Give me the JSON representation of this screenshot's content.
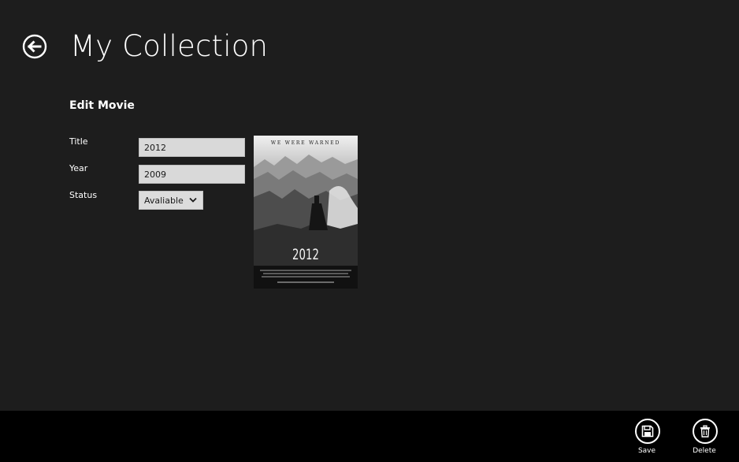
{
  "header": {
    "back_icon": "back-arrow-circle-icon",
    "title": "My Collection"
  },
  "form": {
    "heading": "Edit Movie",
    "fields": {
      "title": {
        "label": "Title",
        "value": "2012"
      },
      "year": {
        "label": "Year",
        "value": "2009"
      },
      "status": {
        "label": "Status",
        "selected": "Avaliable",
        "icon": "chevron-down-icon"
      }
    }
  },
  "poster": {
    "tagline": "WE WERE WARNED",
    "title": "2012"
  },
  "app_bar": {
    "buttons": [
      {
        "label": "Save",
        "icon": "save-disk-icon"
      },
      {
        "label": "Delete",
        "icon": "trash-icon"
      }
    ]
  },
  "colors": {
    "background": "#1d1d1d",
    "app_bar": "#000000",
    "input_background": "#d9d9d9",
    "text": "#ffffff"
  }
}
